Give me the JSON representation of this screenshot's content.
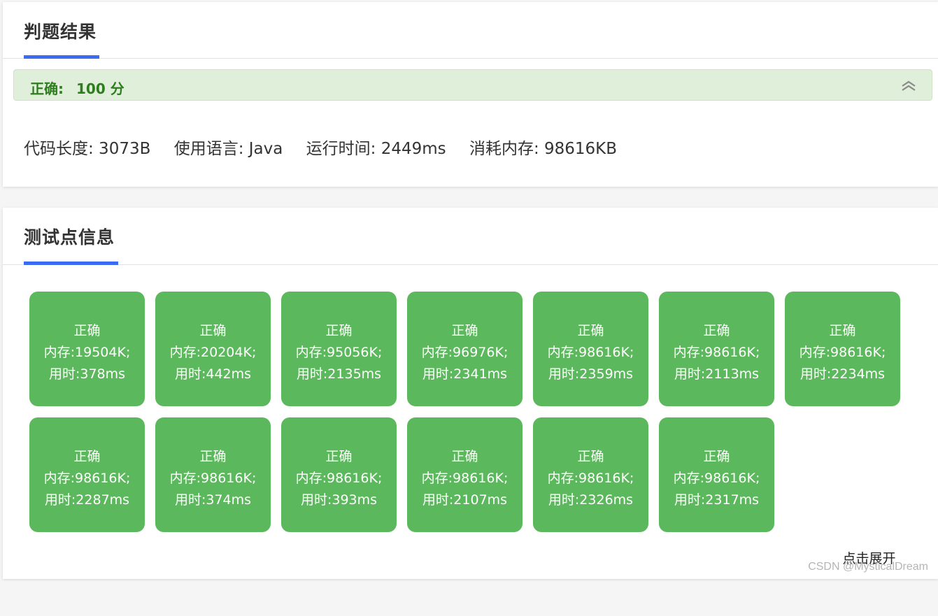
{
  "result_card": {
    "title": "判题结果",
    "status": "正确:",
    "score": "100 分",
    "collapse_icon": "double-chevron-up-icon",
    "meta": {
      "code_length": "代码长度: 3073B",
      "language": "使用语言: Java",
      "run_time": "运行时间: 2449ms",
      "memory": "消耗内存: 98616KB"
    }
  },
  "tests_card": {
    "title": "测试点信息",
    "tiles": [
      {
        "status": "正确",
        "memory": "内存:19504K;",
        "time": "用时:378ms"
      },
      {
        "status": "正确",
        "memory": "内存:20204K;",
        "time": "用时:442ms"
      },
      {
        "status": "正确",
        "memory": "内存:95056K;",
        "time": "用时:2135ms"
      },
      {
        "status": "正确",
        "memory": "内存:96976K;",
        "time": "用时:2341ms"
      },
      {
        "status": "正确",
        "memory": "内存:98616K;",
        "time": "用时:2359ms"
      },
      {
        "status": "正确",
        "memory": "内存:98616K;",
        "time": "用时:2113ms"
      },
      {
        "status": "正确",
        "memory": "内存:98616K;",
        "time": "用时:2234ms"
      },
      {
        "status": "正确",
        "memory": "内存:98616K;",
        "time": "用时:2287ms"
      },
      {
        "status": "正确",
        "memory": "内存:98616K;",
        "time": "用时:374ms"
      },
      {
        "status": "正确",
        "memory": "内存:98616K;",
        "time": "用时:393ms"
      },
      {
        "status": "正确",
        "memory": "内存:98616K;",
        "time": "用时:2107ms"
      },
      {
        "status": "正确",
        "memory": "内存:98616K;",
        "time": "用时:2326ms"
      },
      {
        "status": "正确",
        "memory": "内存:98616K;",
        "time": "用时:2317ms"
      }
    ],
    "expand_label": "点击展开"
  },
  "colors": {
    "accent": "#3b6bf2",
    "success_tile": "#5cb85c",
    "success_bar": "#dfefd9",
    "success_text": "#2e7d1f"
  },
  "watermark": "CSDN @MysticalDream"
}
